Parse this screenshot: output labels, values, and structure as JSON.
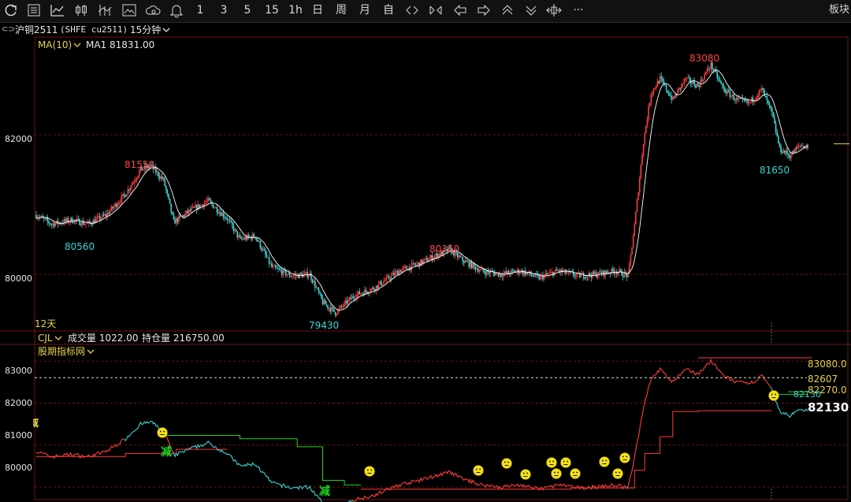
{
  "toolbar": {
    "num_buttons": [
      "1",
      "3",
      "5",
      "15",
      "1h"
    ],
    "cn_buttons": [
      "日",
      "周",
      "月",
      "自"
    ],
    "more": "···",
    "right_label": "板块"
  },
  "instrument": {
    "link_icon": "⊂⊃",
    "name": "沪铜2511",
    "code": "(SHFE cu2511)",
    "period": "15分钟"
  },
  "main_panel": {
    "indicator": "MA(10)",
    "ma_label": "MA1",
    "ma_value": "81831.00",
    "days_label": "12天",
    "y_ticks": [
      "82000",
      "80000"
    ],
    "annotations": {
      "high_left": "81550",
      "low_left": "80560",
      "low_mid": "79430",
      "high_mid": "80350",
      "high_right": "83080",
      "low_right": "81650"
    }
  },
  "sub_panel": {
    "indicator": "CJL",
    "volume_label": "成交量",
    "volume_value": "1022.00",
    "oi_label": "持仓量",
    "oi_value": "216750.00",
    "sub_indicator": "股期指标网",
    "y_ticks": [
      "83000",
      "82000",
      "81000",
      "80000"
    ],
    "levels": {
      "top": "83080.0",
      "mid": "82607",
      "lower": "82270.0",
      "current_tag": "82130",
      "price": "82130"
    },
    "signals": {
      "reduce": "减"
    },
    "signal_icon": "smiley-icon"
  },
  "colors": {
    "up": "#ff3b3b",
    "down": "#35d6d6",
    "ma": "#ffffff",
    "grid": "#6e1414",
    "yellow": "#e8d24a",
    "green": "#21d321"
  },
  "chart_data": {
    "type": "candlestick",
    "interval": "15分钟",
    "ylim_main": [
      79200,
      83400
    ],
    "ylim_sub": [
      79700,
      83400
    ],
    "ma_period": 10,
    "ma_last": 81831.0,
    "anchors": [
      [
        0,
        80850
      ],
      [
        12,
        80720
      ],
      [
        28,
        80780
      ],
      [
        40,
        80720
      ],
      [
        55,
        80850
      ],
      [
        70,
        81150
      ],
      [
        82,
        81500
      ],
      [
        90,
        81550
      ],
      [
        100,
        81350
      ],
      [
        108,
        80750
      ],
      [
        120,
        80900
      ],
      [
        135,
        81050
      ],
      [
        150,
        80800
      ],
      [
        160,
        80500
      ],
      [
        172,
        80550
      ],
      [
        185,
        80100
      ],
      [
        200,
        79980
      ],
      [
        215,
        80000
      ],
      [
        225,
        79600
      ],
      [
        235,
        79450
      ],
      [
        250,
        79700
      ],
      [
        265,
        79800
      ],
      [
        285,
        80050
      ],
      [
        300,
        80150
      ],
      [
        315,
        80280
      ],
      [
        325,
        80350
      ],
      [
        335,
        80200
      ],
      [
        350,
        80050
      ],
      [
        365,
        80000
      ],
      [
        380,
        80050
      ],
      [
        395,
        79950
      ],
      [
        410,
        80050
      ],
      [
        425,
        79980
      ],
      [
        440,
        80000
      ],
      [
        455,
        80050
      ],
      [
        465,
        79980
      ],
      [
        470,
        80700
      ],
      [
        477,
        81900
      ],
      [
        483,
        82600
      ],
      [
        490,
        82800
      ],
      [
        500,
        82500
      ],
      [
        510,
        82800
      ],
      [
        520,
        82700
      ],
      [
        530,
        83000
      ],
      [
        540,
        82650
      ],
      [
        550,
        82500
      ],
      [
        560,
        82450
      ],
      [
        570,
        82650
      ],
      [
        578,
        82300
      ],
      [
        584,
        81800
      ],
      [
        592,
        81700
      ],
      [
        600,
        81850
      ],
      [
        606,
        81830
      ]
    ],
    "price_annotations": [
      {
        "label": "81550",
        "value": 81550
      },
      {
        "label": "80560",
        "value": 80560
      },
      {
        "label": "79430",
        "value": 79430
      },
      {
        "label": "80350",
        "value": 80350
      },
      {
        "label": "83080",
        "value": 83080
      },
      {
        "label": "81650",
        "value": 81650
      }
    ]
  }
}
